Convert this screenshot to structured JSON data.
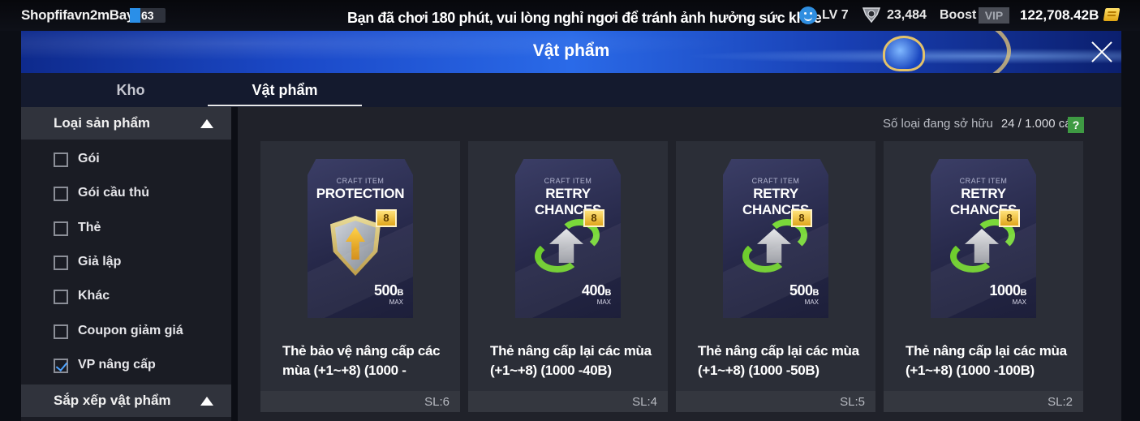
{
  "status_bar": {
    "username": "Shopfifavn2mBay",
    "level_number": "63",
    "level_progress": 0.3,
    "notice": "Bạn đã chơi 180 phút, vui lòng nghỉ ngơi để tránh ảnh hưởng sức khỏe",
    "lv": "LV 7",
    "points": "23,484",
    "boost": "Boost",
    "vip": "VIP",
    "coins": "122,708.42B"
  },
  "window": {
    "title": "Vật phẩm"
  },
  "tabs": [
    {
      "label": "Kho",
      "active": false
    },
    {
      "label": "Vật phẩm",
      "active": true
    }
  ],
  "sidebar": {
    "product_type_header": "Loại sản phẩm",
    "filters": [
      {
        "label": "Gói",
        "checked": false
      },
      {
        "label": "Gói cầu thủ",
        "checked": false
      },
      {
        "label": "Thẻ",
        "checked": false
      },
      {
        "label": "Giả lập",
        "checked": false
      },
      {
        "label": "Khác",
        "checked": false
      },
      {
        "label": "Coupon giảm giá",
        "checked": false
      },
      {
        "label": "VP nâng cấp",
        "checked": true
      }
    ],
    "sort_header": "Sắp xếp vật phẩm"
  },
  "main": {
    "owned_label": "Số loại đang sở hữu",
    "owned_value": "24 / 1.000 cái",
    "help": "?",
    "items": [
      {
        "craft_label": "CRAFT ITEM",
        "art_title": "PROTECTION",
        "icon": "shield-icon",
        "badge": "8",
        "price": "500",
        "price_unit": "B",
        "max_label": "MAX",
        "name": "Thẻ bảo vệ nâng cấp các mùa (+1~+8) (1000 -",
        "qty": "SL:6"
      },
      {
        "craft_label": "CRAFT ITEM",
        "art_title": "RETRY CHANCES",
        "icon": "retry-icon",
        "badge": "8",
        "price": "400",
        "price_unit": "B",
        "max_label": "MAX",
        "name": "Thẻ nâng cấp lại các mùa (+1~+8) (1000 -40B)",
        "qty": "SL:4"
      },
      {
        "craft_label": "CRAFT ITEM",
        "art_title": "RETRY CHANCES",
        "icon": "retry-icon",
        "badge": "8",
        "price": "500",
        "price_unit": "B",
        "max_label": "MAX",
        "name": "Thẻ nâng cấp lại các mùa (+1~+8) (1000 -50B)",
        "qty": "SL:5"
      },
      {
        "craft_label": "CRAFT ITEM",
        "art_title": "RETRY CHANCES",
        "icon": "retry-icon",
        "badge": "8",
        "price": "1000",
        "price_unit": "B",
        "max_label": "MAX",
        "name": "Thẻ nâng cấp lại các mùa (+1~+8) (1000 -100B)",
        "qty": "SL:2"
      }
    ]
  }
}
